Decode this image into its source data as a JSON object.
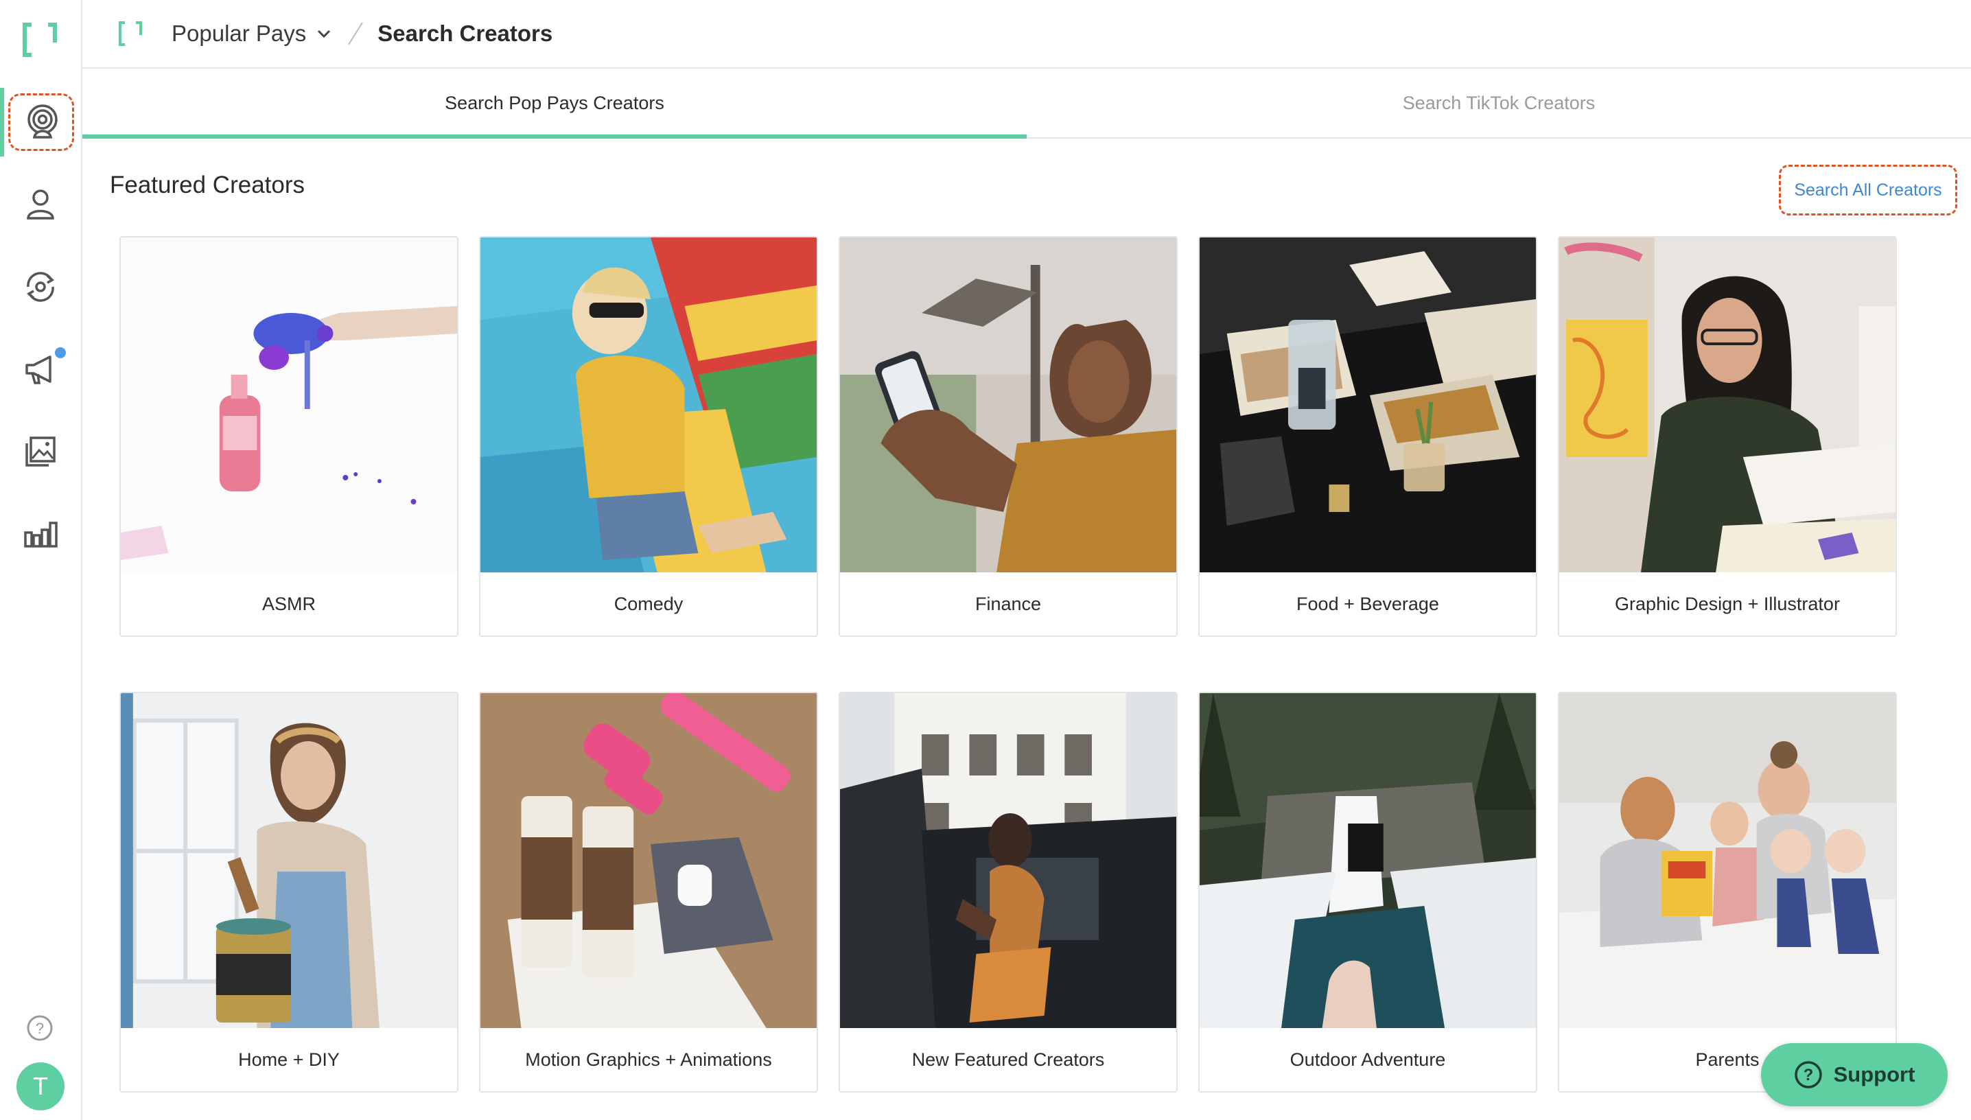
{
  "header": {
    "org_name": "Popular Pays",
    "breadcrumb_current": "Search Creators"
  },
  "tabs": [
    {
      "label": "Search Pop Pays Creators",
      "active": true
    },
    {
      "label": "Search TikTok Creators",
      "active": false
    }
  ],
  "section": {
    "title": "Featured Creators",
    "search_all_label": "Search All Creators"
  },
  "categories": [
    "ASMR",
    "Comedy",
    "Finance",
    "Food + Beverage",
    "Graphic Design + Illustrator",
    "Home + DIY",
    "Motion Graphics + Animations",
    "New Featured Creators",
    "Outdoor Adventure",
    "Parents"
  ],
  "rail": {
    "items": [
      "broadcast-icon",
      "user-icon",
      "refresh-eye-icon",
      "megaphone-icon",
      "gallery-icon",
      "bar-chart-icon"
    ],
    "help_icon": "help-icon",
    "avatar_letter": "T"
  },
  "support": {
    "label": "Support"
  },
  "colors": {
    "accent": "#5ecfa0",
    "link": "#3d86d6",
    "highlight": "#e0531f",
    "notification": "#4e9be8"
  }
}
